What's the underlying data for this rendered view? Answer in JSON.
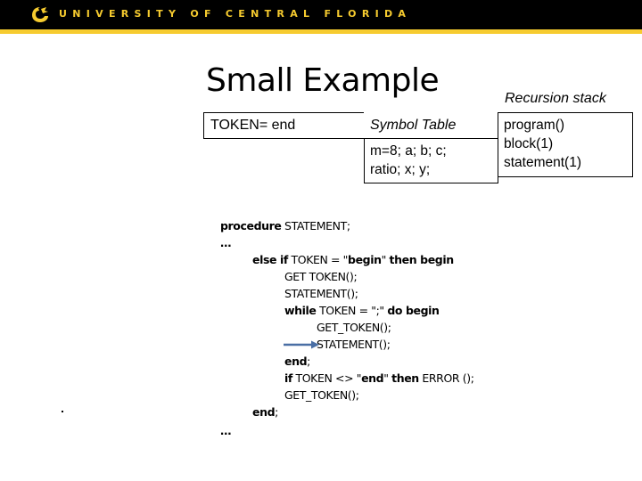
{
  "header": {
    "university_name": "UNIVERSITY OF CENTRAL FLORIDA",
    "logo_icon": "pegasus-logo-icon",
    "brand_colors": {
      "bar": "#000000",
      "accent": "#f6cb2f"
    }
  },
  "slide": {
    "title": "Small Example",
    "recursion_stack_label": "Recursion stack",
    "token_box": "TOKEN= end",
    "symbol_table": {
      "heading": "Symbol Table",
      "lines": [
        "m=8; a; b; c;",
        "ratio; x; y;"
      ]
    },
    "recursion_stack": [
      "program()",
      "block(1)",
      "statement(1)"
    ],
    "code": {
      "l1_kw": "procedure",
      "l1_rest": " STATEMENT;",
      "l2": "…",
      "l3_kw1": "else if",
      "l3_mid": " TOKEN = \"",
      "l3_kw2": "begin",
      "l3_q": "\" ",
      "l3_kw3": "then begin",
      "l4": "GET TOKEN();",
      "l5": "STATEMENT();",
      "l6_kw1": "while",
      "l6_mid": " TOKEN = \";\" ",
      "l6_kw2": "do begin",
      "l7": "GET_TOKEN();",
      "l8": "STATEMENT();",
      "l9_kw": "end",
      "l9_rest": ";",
      "l10_kw1": "if",
      "l10_mid": " TOKEN <> \"",
      "l10_kw2": "end",
      "l10_q": "\" ",
      "l10_kw3": "then",
      "l10_rest": " ERROR ();",
      "l11": "GET_TOKEN();",
      "l12_kw": "end",
      "l12_rest": ";",
      "l13": "…"
    },
    "pointer_arrow_icon": "right-arrow-icon",
    "arrow_color": "#4a6fa5"
  }
}
